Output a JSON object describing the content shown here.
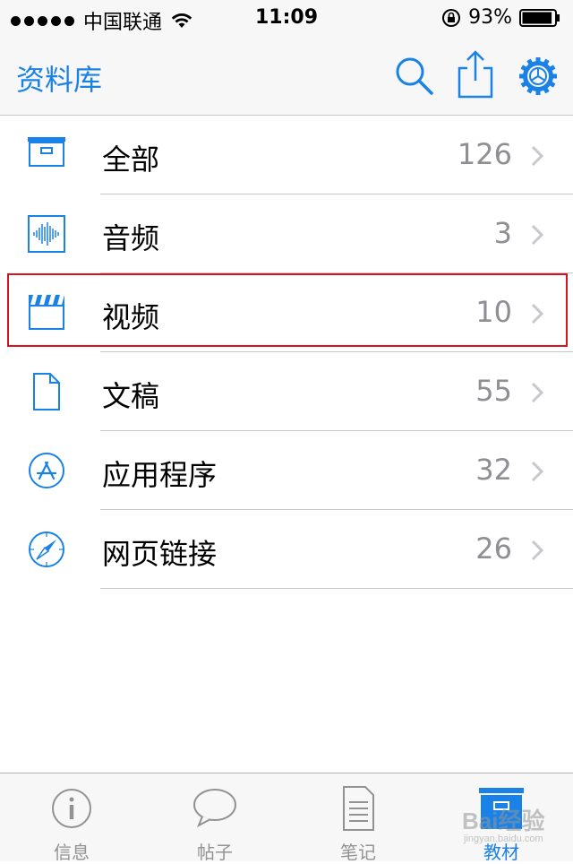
{
  "status_bar": {
    "carrier": "中国联通",
    "time": "11:09",
    "battery_percent": "93%",
    "battery_level": 0.93
  },
  "nav": {
    "title": "资料库",
    "icons": [
      "search-icon",
      "share-icon",
      "gear-icon"
    ]
  },
  "accent_color": "#1a82e6",
  "highlight_color": "#d9121f",
  "list": [
    {
      "label": "全部",
      "count": "126",
      "icon": "archive-box-icon"
    },
    {
      "label": "音频",
      "count": "3",
      "icon": "waveform-icon"
    },
    {
      "label": "视频",
      "count": "10",
      "icon": "clapperboard-icon",
      "highlighted": true
    },
    {
      "label": "文稿",
      "count": "55",
      "icon": "document-icon"
    },
    {
      "label": "应用程序",
      "count": "32",
      "icon": "app-store-icon"
    },
    {
      "label": "网页链接",
      "count": "26",
      "icon": "compass-icon"
    }
  ],
  "tabs": [
    {
      "label": "信息",
      "icon": "info-icon",
      "active": false
    },
    {
      "label": "帖子",
      "icon": "speech-bubble-icon",
      "active": false
    },
    {
      "label": "笔记",
      "icon": "note-icon",
      "active": false
    },
    {
      "label": "教材",
      "icon": "library-box-icon",
      "active": true
    }
  ],
  "watermark": {
    "text": "Bai经验",
    "sub": "jingyan.baidu.com"
  }
}
